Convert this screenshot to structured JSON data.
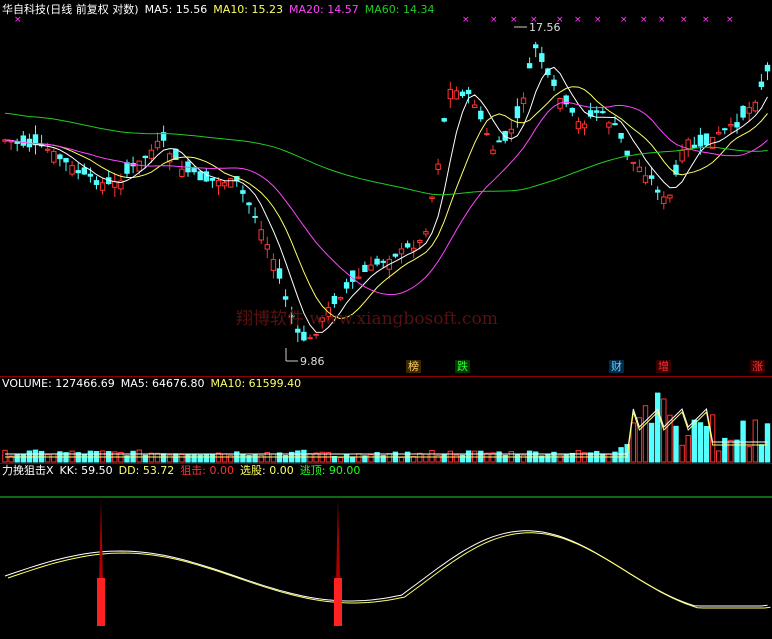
{
  "header": {
    "title": "华自科技(日线 前复权 对数)",
    "ma5": "MA5: 15.56",
    "ma10": "MA10: 15.23",
    "ma20": "MA20: 14.57",
    "ma60": "MA60: 14.34"
  },
  "price_labels": {
    "high": "17.56",
    "low": "9.86"
  },
  "watermark": "翔博软件 www.xiangbosoft.com",
  "event_tags": [
    {
      "text": "榜",
      "color": "#ffcc66"
    },
    {
      "text": "跌",
      "color": "#33ff33"
    },
    {
      "text": "财",
      "color": "#66ccff"
    },
    {
      "text": "增",
      "color": "#ff3333"
    },
    {
      "text": "涨",
      "color": "#ff3333"
    }
  ],
  "volume_header": {
    "volume": "VOLUME: 127466.69",
    "ma5": "MA5: 64676.80",
    "ma10": "MA10: 61599.40"
  },
  "indicator_header": {
    "name": "力挽狙击X",
    "kk": "KK: 59.50",
    "dd": "DD: 53.72",
    "snipe": "狙击: 0.00",
    "pick": "选股: 0.00",
    "escape": "逃顶: 90.00"
  },
  "colors": {
    "up": "#ff3333",
    "down": "#54ffff",
    "ma5": "#ffffff",
    "ma10": "#ffff66",
    "ma20": "#ff44ff",
    "ma60": "#22cc22",
    "axis": "#8b0000"
  },
  "chart_data": {
    "type": "candlestick",
    "scale": "log",
    "bars_approx": 126,
    "price_range": [
      9.86,
      17.56
    ],
    "annotations": [
      "17.56",
      "9.86"
    ],
    "indicator_level": 90
  }
}
